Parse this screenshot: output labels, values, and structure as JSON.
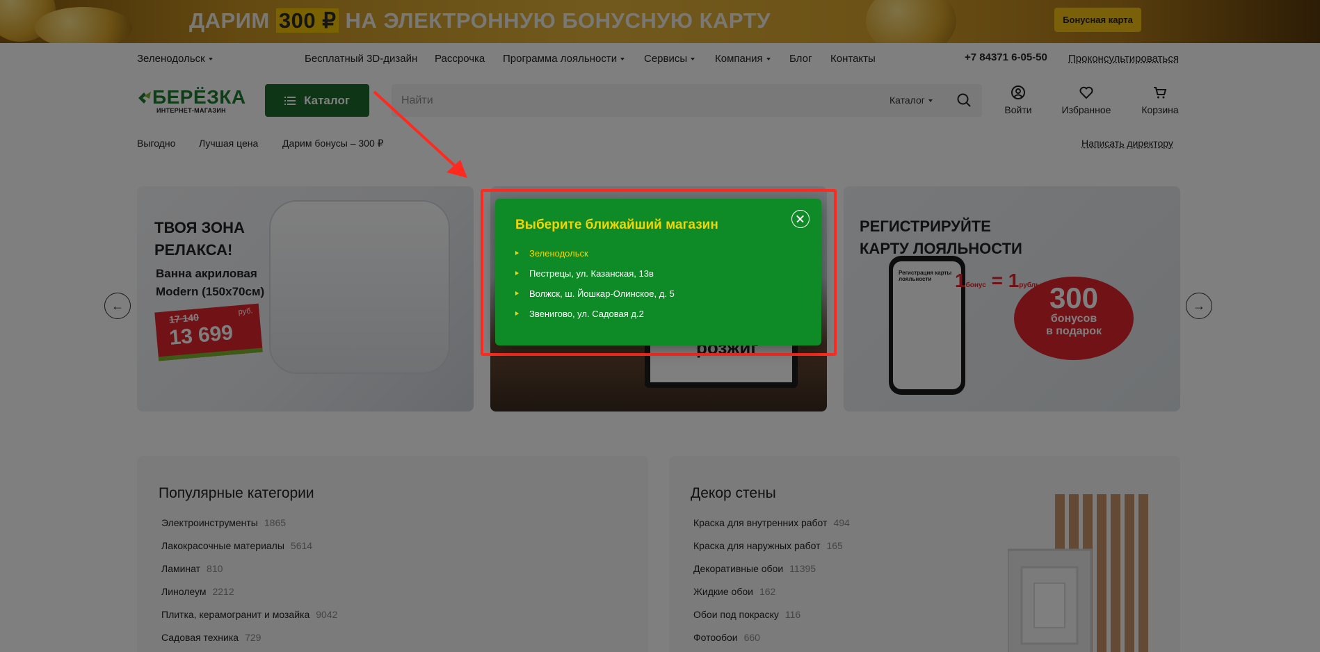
{
  "promo": {
    "text_before": "ДАРИМ ",
    "highlight": "300 ₽",
    "text_after": " НА ЭЛЕКТРОННУЮ БОНУСНУЮ КАРТУ",
    "button": "Бонусная карта"
  },
  "topnav": {
    "city": "Зеленодольск",
    "items": [
      "Бесплатный 3D-дизайн",
      "Рассрочка",
      "Программа лояльности",
      "Сервисы",
      "Компания",
      "Блог",
      "Контакты"
    ],
    "phone": "+7 84371 6-05-50",
    "consult": "Проконсультироваться"
  },
  "logo": {
    "word": "БЕРЁЗКА",
    "sub": "ИНТЕРНЕТ-МАГАЗИН"
  },
  "header": {
    "catalog_button": "Каталог",
    "search_placeholder": "Найти",
    "search_scope": "Каталог",
    "login": "Войти",
    "favorites": "Избранное",
    "cart": "Корзина"
  },
  "subnav": {
    "items": [
      "Выгодно",
      "Лучшая цена",
      "Дарим бонусы – 300 ₽"
    ],
    "right": "Написать директору"
  },
  "slides": {
    "s1": {
      "title1": "ТВОЯ ЗОНА",
      "title2": "РЕЛАКСА!",
      "sub1": "Ванна акриловая",
      "sub2": "Modern (150х70см)",
      "old_price": "17 140",
      "new_price": "13 699",
      "currency": "руб."
    },
    "s2": {
      "text": "розжиг"
    },
    "s3": {
      "title1": "РЕГИСТРИРУЙТЕ",
      "title2": "КАРТУ ЛОЯЛЬНОСТИ",
      "eq_left": "1",
      "eq_left_label": "бонус",
      "eq_sign": "=",
      "eq_right": "1",
      "eq_right_label": "рубль",
      "bubble_big": "300",
      "bubble_small1": "бонусов",
      "bubble_small2": "в подарок",
      "phone_screen_title": "Регистрация карты лояльности"
    }
  },
  "cards": {
    "popular": {
      "title": "Популярные категории",
      "items": [
        {
          "name": "Электроинструменты",
          "count": "1865"
        },
        {
          "name": "Лакокрасочные материалы",
          "count": "5614"
        },
        {
          "name": "Ламинат",
          "count": "810"
        },
        {
          "name": "Линолеум",
          "count": "2212"
        },
        {
          "name": "Плитка, керамогранит и мозайка",
          "count": "9042"
        },
        {
          "name": "Садовая техника",
          "count": "729"
        }
      ]
    },
    "decor": {
      "title": "Декор стены",
      "items": [
        {
          "name": "Краска для внутренних работ",
          "count": "494"
        },
        {
          "name": "Краска для наружных работ",
          "count": "165"
        },
        {
          "name": "Декоративные обои",
          "count": "11395"
        },
        {
          "name": "Жидкие обои",
          "count": "162"
        },
        {
          "name": "Обои под покраску",
          "count": "116"
        },
        {
          "name": "Фотообои",
          "count": "660"
        }
      ]
    }
  },
  "modal": {
    "title": "Выберите ближайший магазин",
    "stores": [
      "Зеленодольск",
      "Пестрецы, ул. Казанская, 13в",
      "Волжск, ш. Йошкар-Олинское, д. 5",
      "Звенигово, ул. Садовая д.2"
    ],
    "active_index": 0
  },
  "colors": {
    "brand_green": "#1c6b2a",
    "modal_green": "#0e8a27",
    "accent_yellow": "#f5d500",
    "annotation_red": "#ff2a1f"
  }
}
